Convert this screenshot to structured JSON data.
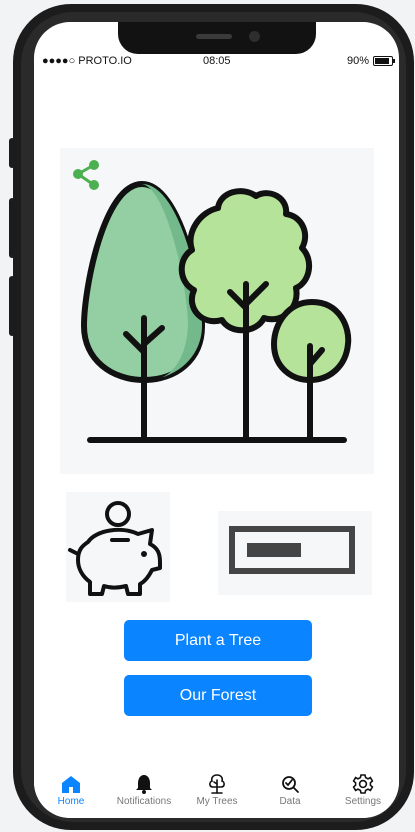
{
  "status": {
    "carrier": "●●●●○ PROTO.IO",
    "time": "08:05",
    "battery": "90%"
  },
  "buttons": {
    "plant": "Plant a Tree",
    "forest": "Our Forest"
  },
  "tabs": [
    {
      "label": "Home",
      "icon": "home-icon",
      "active": true
    },
    {
      "label": "Notifications",
      "icon": "bell-icon"
    },
    {
      "label": "My Trees",
      "icon": "tree-icon"
    },
    {
      "label": "Data",
      "icon": "data-search-icon"
    },
    {
      "label": "Settings",
      "icon": "gear-icon"
    }
  ],
  "colors": {
    "accent": "#0b84ff",
    "share": "#4caf50",
    "tree_light": "#b6e39a",
    "tree_mid": "#93cfa2"
  }
}
